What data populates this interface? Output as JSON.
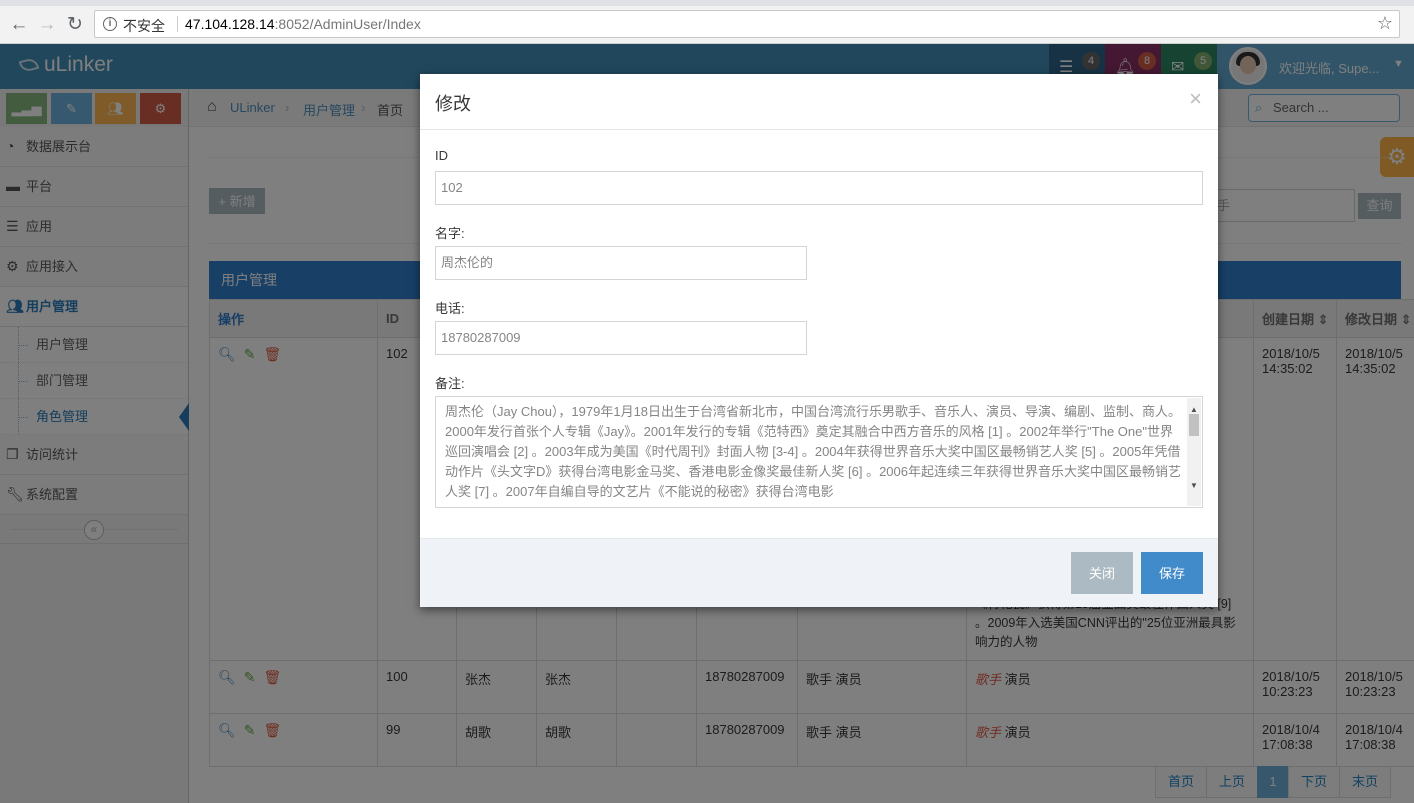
{
  "browser": {
    "insecure_label": "不安全",
    "url_host": "47.104.128.14",
    "url_rest": ":8052/AdminUser/Index"
  },
  "navbar": {
    "brand": "uLinker",
    "tasks_count": "4",
    "notifications_count": "8",
    "messages_count": "5",
    "user_greeting": "欢迎光临, Supe..."
  },
  "sidebar": {
    "items": [
      {
        "label": "数据展示台"
      },
      {
        "label": "平台"
      },
      {
        "label": "应用"
      },
      {
        "label": "应用接入"
      },
      {
        "label": "用户管理"
      },
      {
        "label": "访问统计"
      },
      {
        "label": "系统配置"
      }
    ],
    "subitems": [
      {
        "label": "用户管理"
      },
      {
        "label": "部门管理"
      },
      {
        "label": "角色管理"
      }
    ],
    "collapse_icon": "«"
  },
  "breadcrumb": {
    "home": "ULinker",
    "section": "用户管理",
    "current": "首页"
  },
  "search": {
    "placeholder": "Search ..."
  },
  "toolbar": {
    "add_label": "+ 新增",
    "query_placeholder": "手",
    "query_label": "查询"
  },
  "table": {
    "title": "用户管理",
    "headers": [
      "操作",
      "ID",
      "",
      "",
      "",
      "",
      "",
      "",
      "创建日期",
      "修改日期"
    ],
    "rows": [
      {
        "id": "102",
        "name": "",
        "nick": "",
        "dept": "",
        "phone": "",
        "role": "",
        "note": "…生于…乐…0年…专辑…座》…\"全…跨…并…同…年登…华语…奖…《青花瓷》获得第19届金曲奖最佳作曲人奖 [9] 。2009年入选美国CNN评出的\"25位亚洲最具影响力的人物",
        "created": "2018/10/5 14:35:02",
        "modified": "2018/10/5 14:35:02"
      },
      {
        "id": "100",
        "name": "张杰",
        "nick": "张杰",
        "dept": "",
        "phone": "18780287009",
        "role": "歌手 演员",
        "note_tag": "歌手",
        "note_rest": " 演员",
        "created": "2018/10/5 10:23:23",
        "modified": "2018/10/5 10:23:23"
      },
      {
        "id": "99",
        "name": "胡歌",
        "nick": "胡歌",
        "dept": "",
        "phone": "18780287009",
        "role": "歌手 演员",
        "note_tag": "歌手",
        "note_rest": " 演员",
        "created": "2018/10/4 17:08:38",
        "modified": "2018/10/4 17:08:38"
      }
    ]
  },
  "pager": {
    "first": "首页",
    "prev": "上页",
    "current": "1",
    "next": "下页",
    "last": "末页"
  },
  "modal": {
    "title": "修改",
    "close_glyph": "×",
    "id_label": "ID",
    "id_value": "102",
    "name_label": "名字:",
    "name_value": "周杰伦的",
    "phone_label": "电话:",
    "phone_value": "18780287009",
    "note_label": "备注:",
    "note_value": "周杰伦（Jay Chou），1979年1月18日出生于台湾省新北市，中国台湾流行乐男歌手、音乐人、演员、导演、编剧、监制、商人。2000年发行首张个人专辑《Jay》。2001年发行的专辑《范特西》奠定其融合中西方音乐的风格 [1] 。2002年举行\"The One\"世界巡回演唱会 [2] 。2003年成为美国《时代周刊》封面人物 [3-4] 。2004年获得世界音乐大奖中国区最畅销艺人奖 [5] 。2005年凭借动作片《头文字D》获得台湾电影金马奖、香港电影金像奖最佳新人奖 [6] 。2006年起连续三年获得世界音乐大奖中国区最畅销艺人奖 [7] 。2007年自编自导的文艺片《不能说的秘密》获得台湾电影",
    "close_label": "关闭",
    "save_label": "保存"
  },
  "colors": {
    "navbar": "#438eb9",
    "accent": "#307ecc",
    "danger": "#dd5a43",
    "success": "#69aa46"
  }
}
